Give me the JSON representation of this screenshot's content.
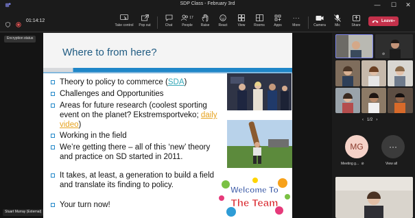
{
  "window": {
    "title": "SDP Class - February 3rd",
    "minimize": "—",
    "maximize": "☐",
    "close": "✕"
  },
  "timer": "01:14:12",
  "toolbar": {
    "take_control": "Take control",
    "pop_out": "Pop out",
    "chat": "Chat",
    "people": "People",
    "people_count": "17",
    "raise": "Raise",
    "react": "React",
    "view": "View",
    "rooms": "Rooms",
    "apps": "Apps",
    "more": "More",
    "camera": "Camera",
    "mic": "Mic",
    "share": "Share",
    "leave": "Leave"
  },
  "encryption_status": "Encryption status",
  "slide": {
    "title": "Where to from here?",
    "bullets": [
      {
        "pre": "Theory to policy to commerce (",
        "link": "SDA",
        "post": ")"
      },
      {
        "text": "Challenges and Opportunities"
      },
      {
        "text": "Areas for future research (coolest sporting event on the planet? Ekstremsportveko;",
        "link": "daily video",
        "post": ")"
      },
      {
        "text": "Working in the field"
      },
      {
        "text": "We’re getting there – all of this ‘new’ theory and practice on SD started in 2011."
      },
      {
        "text": "It takes, at least, a generation to build a field and translate its finding to policy."
      },
      {
        "text": "Your turn now!"
      }
    ],
    "welcome_line1": "Welcome To",
    "welcome_line2": "The Team"
  },
  "presenter_name": "Stuart Murray (External)",
  "pager": {
    "text": "1/2"
  },
  "participants": {
    "meeting_label": "Meeting g...",
    "avatar_initials": "MG",
    "view_all": "View all"
  },
  "colors": {
    "leave": "#c4314b",
    "slide_title": "#1f5b82",
    "band": "#1f86c8",
    "teal_link": "#35a8b8",
    "orange_link": "#e6a21e"
  }
}
